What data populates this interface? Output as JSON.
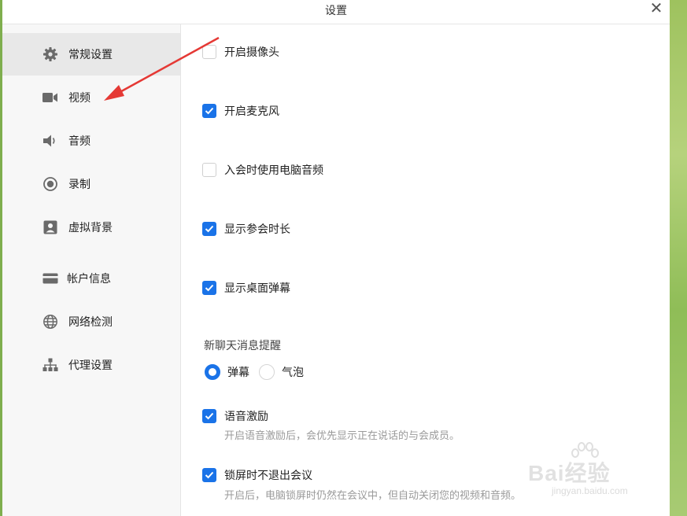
{
  "window": {
    "title": "设置"
  },
  "sidebar": {
    "items": [
      {
        "label": "常规设置",
        "icon": "gear-icon",
        "active": true
      },
      {
        "label": "视频",
        "icon": "video-camera-icon",
        "active": false
      },
      {
        "label": "音频",
        "icon": "speaker-icon",
        "active": false
      },
      {
        "label": "录制",
        "icon": "record-icon",
        "active": false
      },
      {
        "label": "虚拟背景",
        "icon": "portrait-icon",
        "active": false
      },
      {
        "label": "帐户信息",
        "icon": "card-icon",
        "active": false
      },
      {
        "label": "网络检测",
        "icon": "globe-icon",
        "active": false
      },
      {
        "label": "代理设置",
        "icon": "network-tree-icon",
        "active": false
      }
    ]
  },
  "settings": {
    "options": [
      {
        "label": "开启摄像头",
        "checked": false
      },
      {
        "label": "开启麦克风",
        "checked": true
      },
      {
        "label": "入会时使用电脑音频",
        "checked": false
      },
      {
        "label": "显示参会时长",
        "checked": true
      },
      {
        "label": "显示桌面弹幕",
        "checked": true
      }
    ],
    "chat_notify": {
      "title": "新聊天消息提醒",
      "choices": [
        {
          "label": "弹幕",
          "selected": true
        },
        {
          "label": "气泡",
          "selected": false
        }
      ]
    },
    "voice_motivation": {
      "label": "语音激励",
      "checked": true,
      "desc": "开启语音激励后，会优先显示正在说话的与会成员。"
    },
    "lock_screen": {
      "label": "锁屏时不退出会议",
      "checked": true,
      "desc": "开启后，电脑锁屏时仍然在会议中，但自动关闭您的视频和音频。"
    }
  },
  "watermark": {
    "text": "Bai经验",
    "url": "jingyan.baidu.com"
  },
  "colors": {
    "accent": "#1a73e8",
    "arrow": "#e53935",
    "active_bg": "#e8e8e8"
  }
}
